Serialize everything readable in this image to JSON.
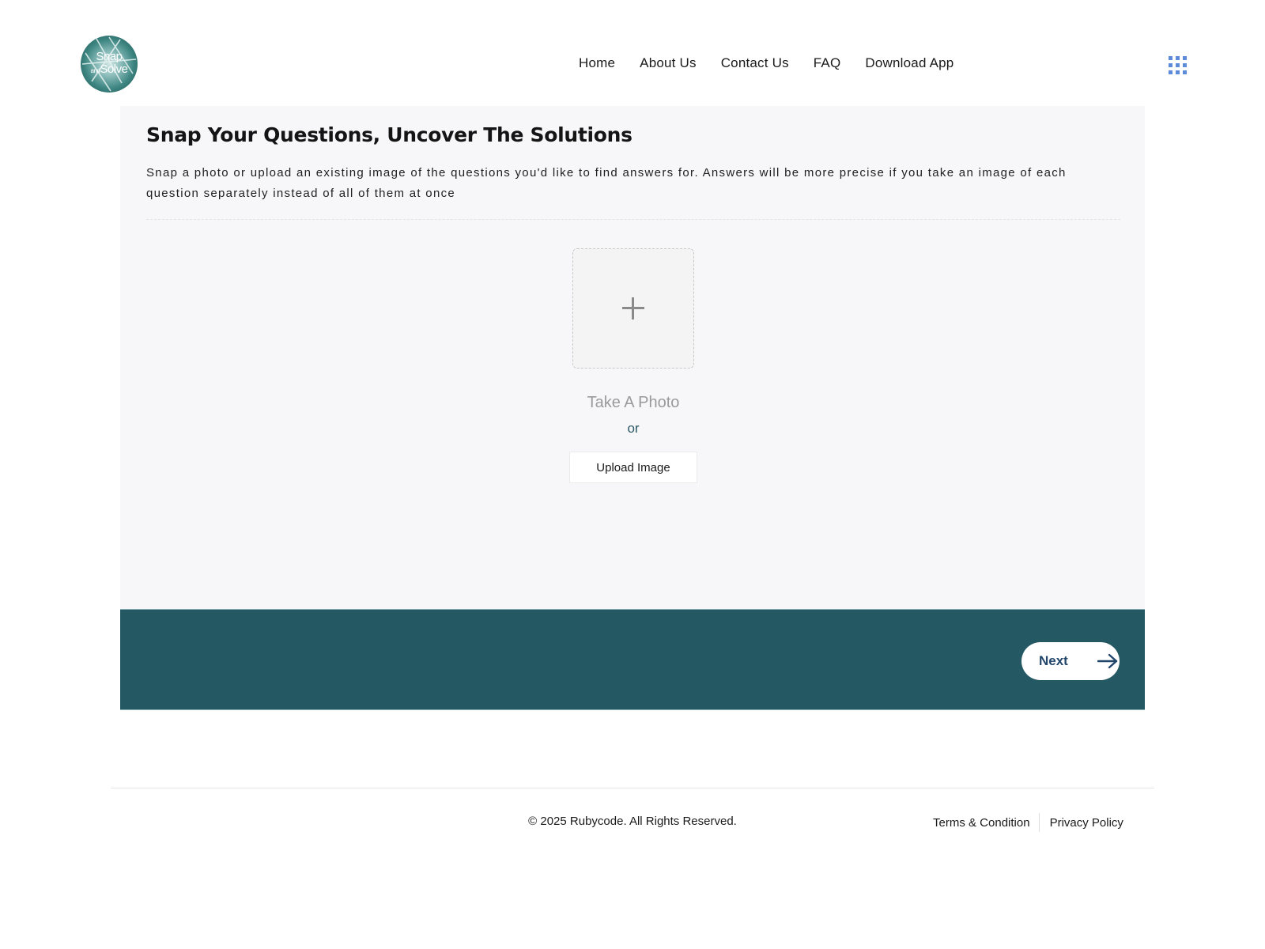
{
  "header": {
    "logo": {
      "line1": "Snap",
      "line2_small": "and",
      "line2": "Solve"
    },
    "nav": [
      {
        "label": "Home"
      },
      {
        "label": "About Us"
      },
      {
        "label": "Contact Us"
      },
      {
        "label": "FAQ"
      },
      {
        "label": "Download App"
      }
    ],
    "menu_icon": "grid-dots-icon"
  },
  "main": {
    "title": "Snap Your Questions, Uncover The Solutions",
    "description": "Snap a photo or upload an existing image of the questions you'd like to find answers for. Answers will be more precise if you take an image of each question separately instead of all of them at once",
    "dropzone_icon": "plus-icon",
    "take_photo_label": "Take A Photo",
    "or_label": "or",
    "upload_label": "Upload Image"
  },
  "action_bar": {
    "next_label": "Next",
    "next_icon": "arrow-right-icon"
  },
  "footer": {
    "copyright": "© 2025 Rubycode. All Rights Reserved.",
    "links": [
      {
        "label": "Terms & Condition"
      },
      {
        "label": "Privacy Policy"
      }
    ]
  },
  "colors": {
    "action_bar_bg": "#245862",
    "next_text": "#22466a",
    "menu_icon": "#5b8bd9",
    "card_bg": "#f7f6f9"
  }
}
